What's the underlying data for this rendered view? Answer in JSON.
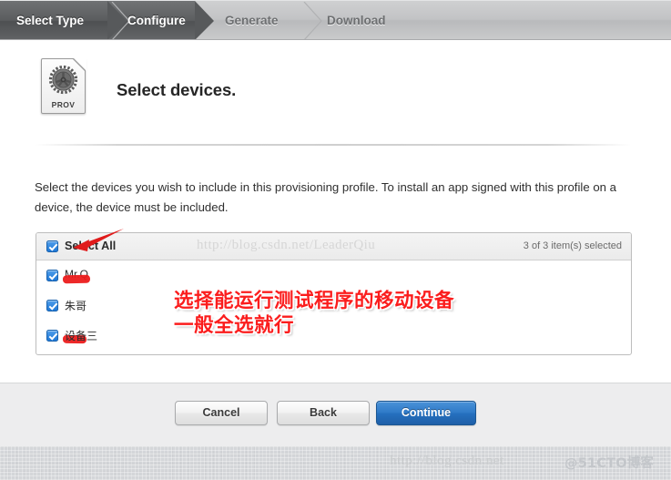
{
  "window": {
    "title": "Select devices."
  },
  "stepbar": {
    "steps": [
      {
        "label": "Select Type",
        "state": "done"
      },
      {
        "label": "Configure",
        "state": "current"
      },
      {
        "label": "Generate",
        "state": "todo"
      },
      {
        "label": "Download",
        "state": "todo"
      }
    ]
  },
  "header": {
    "icon_name": "provisioning-profile-document-icon",
    "icon_label": "PROV",
    "title": "Select devices."
  },
  "description": "Select the devices you wish to include in this provisioning profile. To install an app signed with this profile on a device, the device must be included.",
  "device_list": {
    "select_all_label": "Select All",
    "count_label": "3 of 3 item(s) selected",
    "watermark": "http://blog.csdn.net/LeaderQiu",
    "select_all_checked": true,
    "rows": [
      {
        "name": "Mr.Q",
        "checked": true,
        "redacted": true,
        "redact_width": 30
      },
      {
        "name": "朱哥",
        "checked": true,
        "redacted": true,
        "redact_width": 26
      },
      {
        "name": "设备三",
        "checked": true,
        "redacted": true,
        "redact_width": 28
      }
    ]
  },
  "footer": {
    "cancel_label": "Cancel",
    "back_label": "Back",
    "continue_label": "Continue"
  },
  "annotations": {
    "chinese_note": "选择能运行测试程序的移动设备\n一般全选就行",
    "arrow_name": "red-arrow-pointing-at-select-all",
    "arrow_color": "#e01b1b"
  },
  "watermarks": {
    "bottom_url": "http://blog.csdn.net",
    "bottom_brand": "@51CTO博客"
  },
  "colors": {
    "primary_button": "#2570bf",
    "checkbox": "#1f78d6",
    "annotation_red": "#fb1d1d",
    "step_active": "#57595b"
  }
}
